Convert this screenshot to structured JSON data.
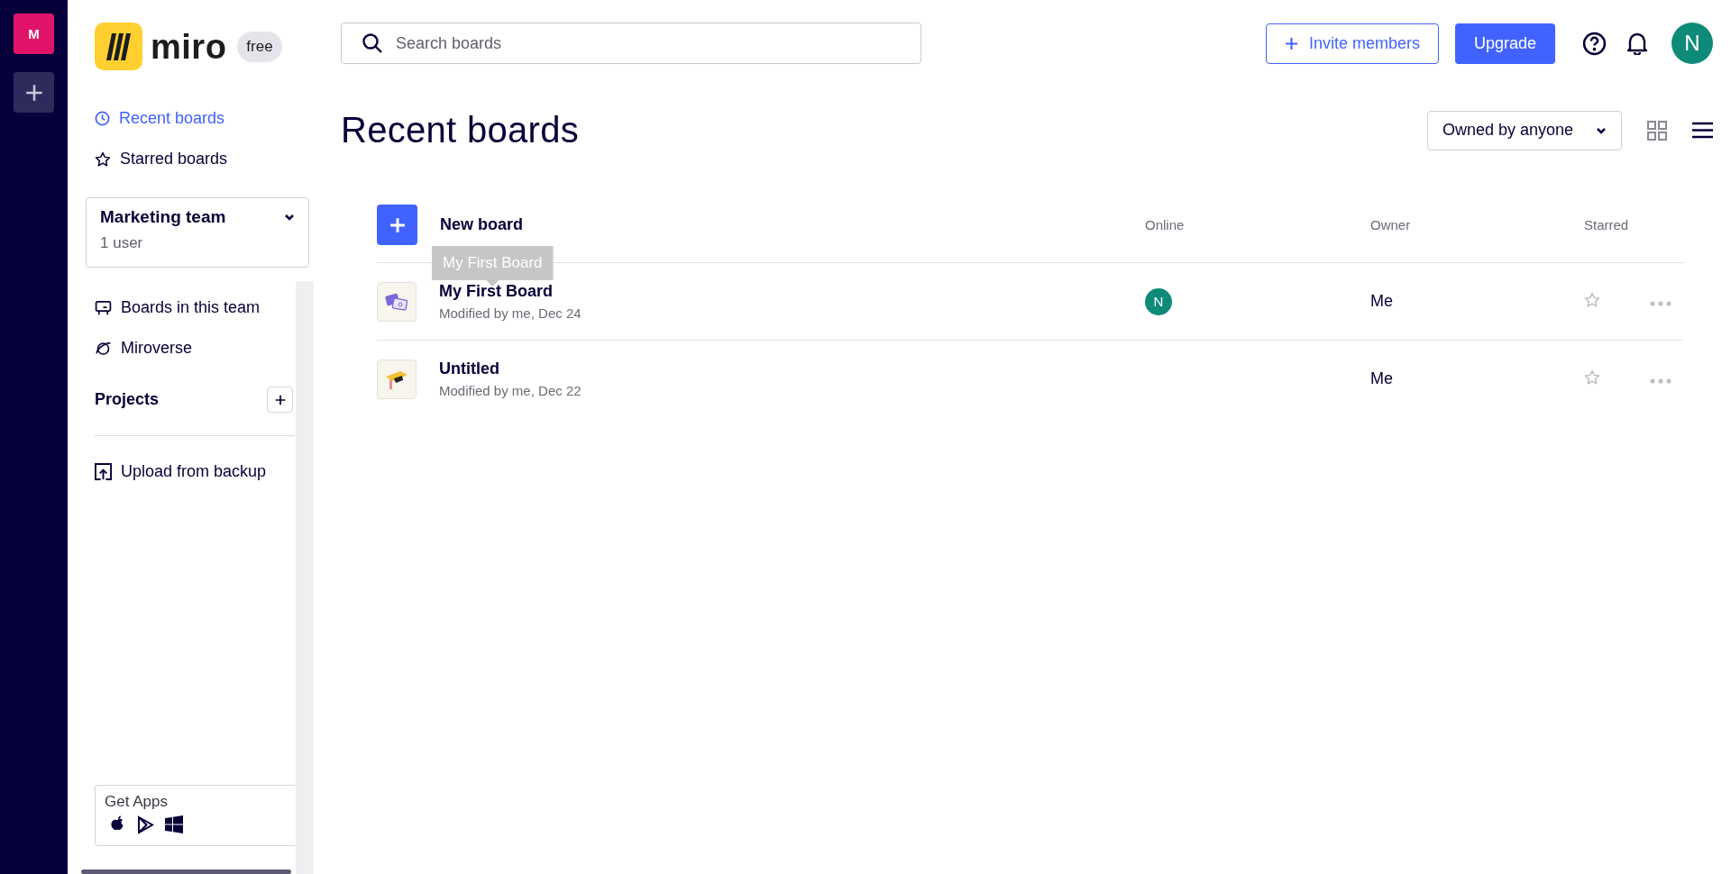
{
  "workspace_rail": {
    "workspaces": [
      {
        "initial": "M"
      }
    ]
  },
  "logo": {
    "wordmark": "miro",
    "plan_badge": "free"
  },
  "sidebar": {
    "nav": [
      {
        "label": "Recent boards",
        "selected": true
      },
      {
        "label": "Starred boards",
        "selected": false
      }
    ],
    "team": {
      "name": "Marketing team",
      "members": "1 user"
    },
    "team_nav": [
      {
        "label": "Boards in this team"
      },
      {
        "label": "Miroverse"
      }
    ],
    "projects": {
      "title": "Projects"
    },
    "upload": {
      "label": "Upload from backup"
    },
    "get_apps": {
      "title": "Get Apps"
    }
  },
  "header": {
    "search": {
      "placeholder": "Search boards"
    },
    "invite_button": "Invite members",
    "upgrade_button": "Upgrade",
    "avatar": "N"
  },
  "page": {
    "title": "Recent boards",
    "filter": "Owned by anyone",
    "views": [
      {
        "kind": "grid",
        "selected": false
      },
      {
        "kind": "list",
        "selected": true
      }
    ]
  },
  "table": {
    "new_board": "New board",
    "columns": [
      "Online",
      "Owner",
      "Starred"
    ],
    "tooltip": "My First Board",
    "rows": [
      {
        "name": "My First Board",
        "modified": "Modified by me, Dec 24",
        "online": "N",
        "owner": "Me",
        "starred": false
      },
      {
        "name": "Untitled",
        "modified": "Modified by me, Dec 22",
        "owner": "Me",
        "starred": false
      }
    ]
  }
}
